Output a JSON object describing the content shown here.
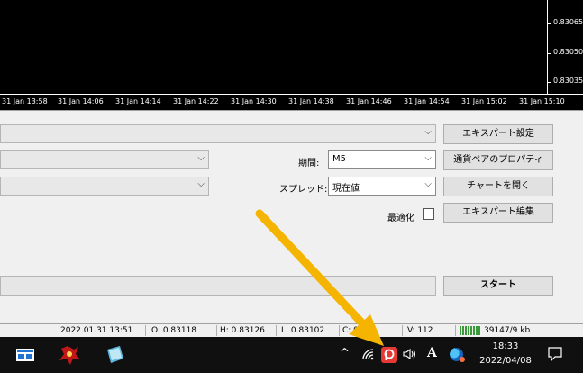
{
  "chart": {
    "prices": [
      "0.83065",
      "0.83050",
      "0.83035"
    ],
    "times": [
      "31 Jan 13:58",
      "31 Jan 14:06",
      "31 Jan 14:14",
      "31 Jan 14:22",
      "31 Jan 14:30",
      "31 Jan 14:38",
      "31 Jan 14:46",
      "31 Jan 14:54",
      "31 Jan 15:02",
      "31 Jan 15:10"
    ]
  },
  "tester": {
    "expert_combo": "",
    "symbol_combo": "",
    "model_combo": "",
    "period_label": "期間:",
    "period_value": "M5",
    "spread_label": "スプレッド:",
    "spread_value": "現在値",
    "optimization_label": "最適化",
    "optimization_checked": false,
    "buttons": {
      "expert_settings": "エキスパート設定",
      "symbol_properties": "通貨ペアのプロパティ",
      "open_chart": "チャートを開く",
      "edit_expert": "エキスパート編集",
      "start": "スタート"
    }
  },
  "status": {
    "datetime": "2022.01.31 13:51",
    "open": "O: 0.83118",
    "high": "H: 0.83126",
    "low": "L: 0.83102",
    "close": "C: 0.83...",
    "volume": "V: 112",
    "traffic": "39147/9 kb"
  },
  "taskbar": {
    "time": "18:33",
    "date": "2022/04/08",
    "ime": "A",
    "colors": {
      "accent_arrow": "#F5B400",
      "tray_app": "#E53935"
    }
  }
}
